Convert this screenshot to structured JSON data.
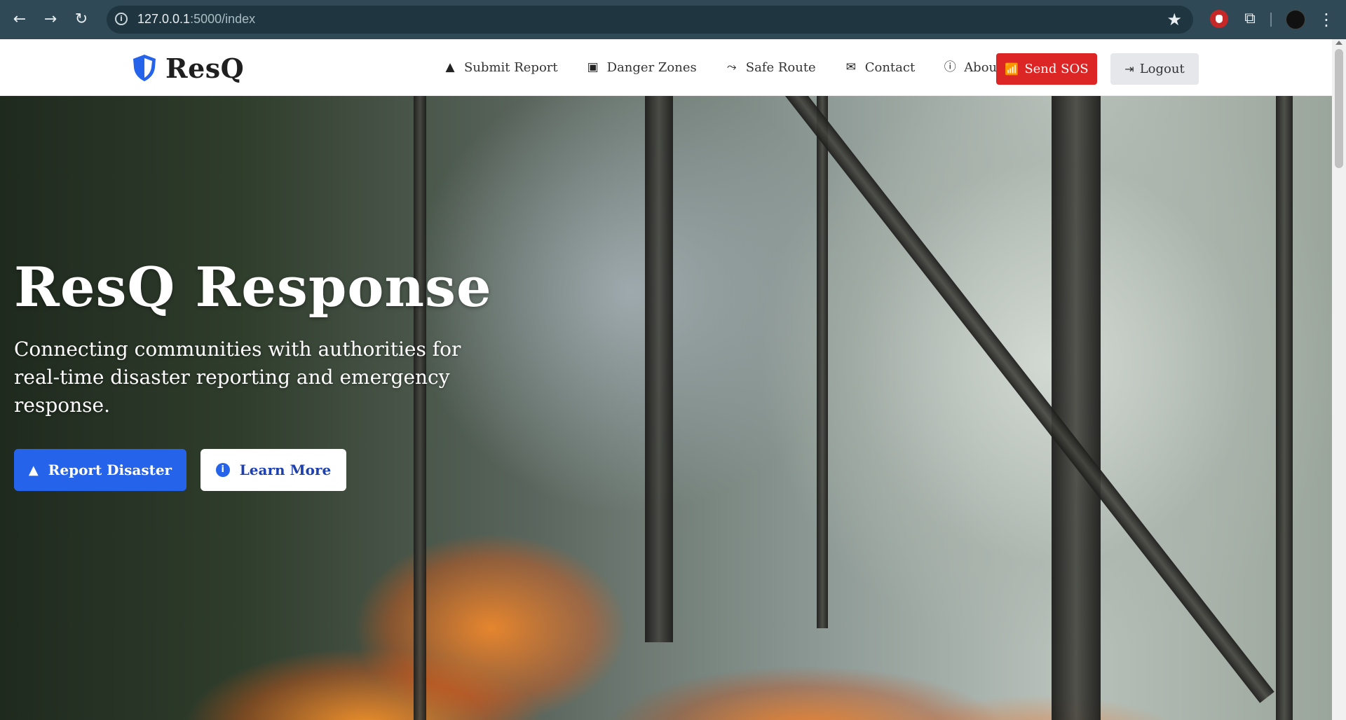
{
  "browser": {
    "url_host": "127.0.0.1",
    "url_path": ":5000/index",
    "back_icon": "arrow-left-icon",
    "forward_icon": "arrow-right-icon",
    "reload_icon": "reload-icon",
    "info_icon": "info-icon",
    "bookmark_icon": "star-icon"
  },
  "navbar": {
    "brand": "ResQ",
    "brand_color": "#2563eb",
    "links": [
      {
        "label": "Submit Report",
        "icon": "warning-icon"
      },
      {
        "label": "Danger Zones",
        "icon": "map-marker-icon"
      },
      {
        "label": "Safe Route",
        "icon": "route-icon"
      },
      {
        "label": "Contact",
        "icon": "envelope-icon"
      },
      {
        "label": "About",
        "icon": "info-circle-icon"
      }
    ],
    "sos_label": "Send SOS",
    "sos_color": "#dc2626",
    "logout_label": "Logout"
  },
  "hero": {
    "title": "ResQ Response",
    "subtitle": "Connecting communities with authorities for real-time disaster reporting and emergency response.",
    "primary_button": "Report Disaster",
    "secondary_button": "Learn More",
    "primary_color": "#2563eb"
  }
}
